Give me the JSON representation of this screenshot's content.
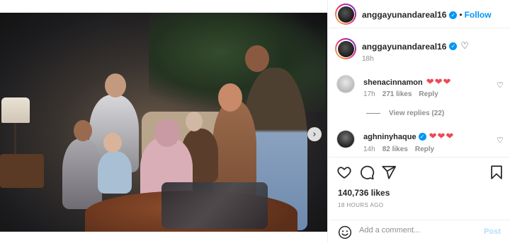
{
  "post": {
    "author": "anggayunandareal16",
    "follow_label": "Follow",
    "separator": "•",
    "caption_time": "18h",
    "likes": "140,736 likes",
    "timestamp": "18 HOURS AGO",
    "image_alt_icon": "family-photo",
    "carousel": {
      "total_dots": 8,
      "active_index": 0,
      "next_icon": "›"
    }
  },
  "comments": [
    {
      "user": "shenacinnamon",
      "text": "❤❤❤",
      "time": "17h",
      "likes": "271 likes",
      "reply_label": "Reply",
      "verified": false
    },
    {
      "user": "aghninyhaque",
      "text": "❤❤❤",
      "time": "14h",
      "likes": "82 likes",
      "reply_label": "Reply",
      "verified": true
    }
  ],
  "view_replies": "View replies (22)",
  "composer": {
    "placeholder": "Add a comment...",
    "post_label": "Post"
  },
  "icons": {
    "verified": "✓",
    "heart_outline": "♡",
    "like": "heart-outline-icon",
    "comment": "comment-bubble-icon",
    "share": "paper-plane-icon",
    "save": "bookmark-icon",
    "emoji": "smiley-icon"
  },
  "colors": {
    "accent": "#0095f6",
    "heart_red": "#ed4956",
    "muted": "#8e8e8e"
  }
}
